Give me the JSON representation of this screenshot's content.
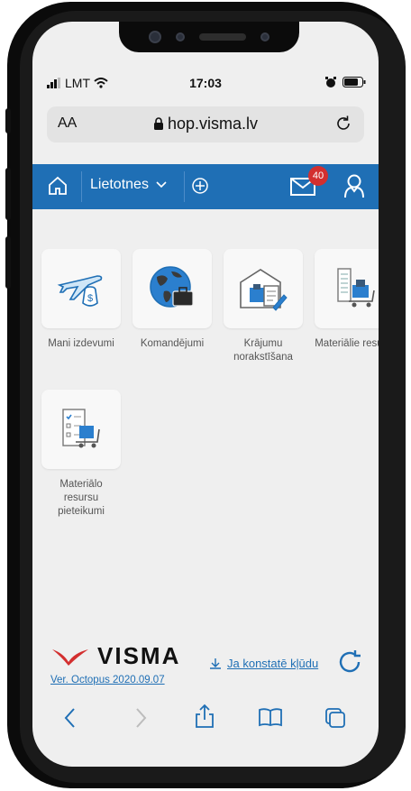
{
  "status_bar": {
    "carrier": "LMT",
    "time": "17:03"
  },
  "browser": {
    "text_size_label": "AA",
    "url": "hop.visma.lv"
  },
  "app_nav": {
    "apps_label": "Lietotnes",
    "mail_badge": "40",
    "accent_color": "#1f6fb5"
  },
  "tiles": [
    {
      "label": "Mani izdevumi",
      "icon": "plane-money-icon"
    },
    {
      "label": "Komandējumi",
      "icon": "globe-briefcase-icon"
    },
    {
      "label": "Krājumu norakstīšana",
      "icon": "warehouse-write-off-icon"
    },
    {
      "label": "Materiālie resursi",
      "icon": "building-cart-icon"
    },
    {
      "label": "Materiālo resursu pieteikumi",
      "icon": "checklist-cart-icon"
    }
  ],
  "footer": {
    "brand": "VISMA",
    "version": "Ver. Octopus 2020.09.07",
    "report_link": "Ja konstatē kļūdu"
  }
}
